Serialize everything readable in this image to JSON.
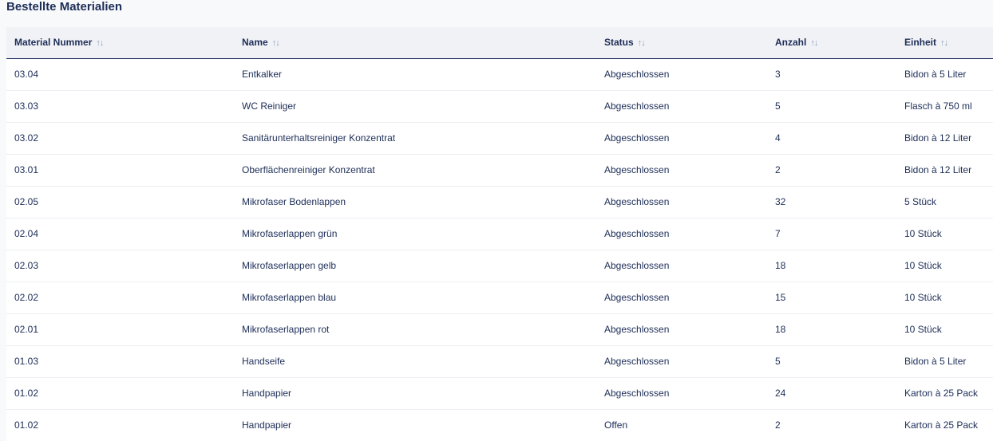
{
  "page": {
    "title": "Bestellte Materialien"
  },
  "table": {
    "columns": [
      {
        "label": "Material Nummer",
        "sort_icon": "sort-arrows-icon"
      },
      {
        "label": "Name",
        "sort_icon": "sort-arrows-icon"
      },
      {
        "label": "Status",
        "sort_icon": "sort-arrows-icon"
      },
      {
        "label": "Anzahl",
        "sort_icon": "sort-arrows-icon"
      },
      {
        "label": "Einheit",
        "sort_icon": "sort-arrows-icon"
      }
    ],
    "sort_glyph": "↑↓",
    "rows": [
      {
        "nummer": "03.04",
        "name": "Entkalker",
        "status": "Abgeschlossen",
        "anzahl": "3",
        "einheit": "Bidon à 5 Liter"
      },
      {
        "nummer": "03.03",
        "name": "WC Reiniger",
        "status": "Abgeschlossen",
        "anzahl": "5",
        "einheit": "Flasch à 750 ml"
      },
      {
        "nummer": "03.02",
        "name": "Sanitärunterhaltsreiniger Konzentrat",
        "status": "Abgeschlossen",
        "anzahl": "4",
        "einheit": "Bidon à 12 Liter"
      },
      {
        "nummer": "03.01",
        "name": "Oberflächenreiniger Konzentrat",
        "status": "Abgeschlossen",
        "anzahl": "2",
        "einheit": "Bidon à 12 Liter"
      },
      {
        "nummer": "02.05",
        "name": "Mikrofaser Bodenlappen",
        "status": "Abgeschlossen",
        "anzahl": "32",
        "einheit": "5 Stück"
      },
      {
        "nummer": "02.04",
        "name": "Mikrofaserlappen grün",
        "status": "Abgeschlossen",
        "anzahl": "7",
        "einheit": "10 Stück"
      },
      {
        "nummer": "02.03",
        "name": "Mikrofaserlappen gelb",
        "status": "Abgeschlossen",
        "anzahl": "18",
        "einheit": "10 Stück"
      },
      {
        "nummer": "02.02",
        "name": "Mikrofaserlappen blau",
        "status": "Abgeschlossen",
        "anzahl": "15",
        "einheit": "10 Stück"
      },
      {
        "nummer": "02.01",
        "name": "Mikrofaserlappen rot",
        "status": "Abgeschlossen",
        "anzahl": "18",
        "einheit": "10 Stück"
      },
      {
        "nummer": "01.03",
        "name": "Handseife",
        "status": "Abgeschlossen",
        "anzahl": "5",
        "einheit": "Bidon à 5 Liter"
      },
      {
        "nummer": "01.02",
        "name": "Handpapier",
        "status": "Abgeschlossen",
        "anzahl": "24",
        "einheit": "Karton à 25 Pack"
      },
      {
        "nummer": "01.02",
        "name": "Handpapier",
        "status": "Offen",
        "anzahl": "2",
        "einheit": "Karton à 25 Pack"
      }
    ]
  },
  "colors": {
    "text": "#1c2d57",
    "header_bg": "#f1f2f6",
    "header_border": "#1f2f5e",
    "row_border": "#eceef3",
    "sort_icon": "#8a9bbd"
  }
}
